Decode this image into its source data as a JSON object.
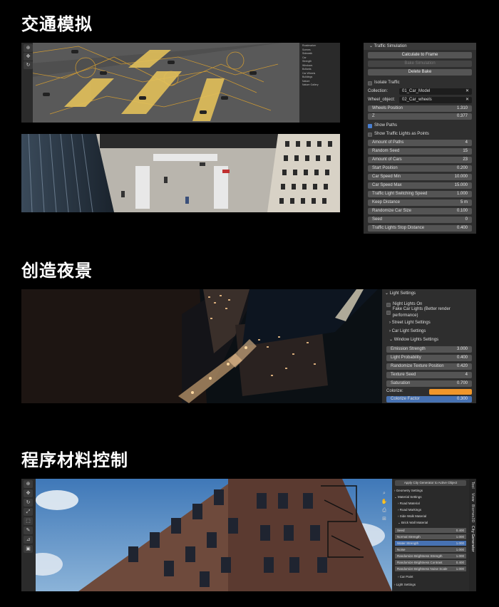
{
  "sections": {
    "traffic": {
      "title": "交通模拟"
    },
    "night": {
      "title": "创造夜景"
    },
    "materials": {
      "title": "程序材料控制"
    }
  },
  "traffic_panel": {
    "header": "Traffic Simulation",
    "buttons": [
      "Calculate to Frame",
      "Bake Simulation",
      "Delete Bake"
    ],
    "isolate_label": "Isolate Traffic",
    "collection_label": "Collection:",
    "collection_value": "01_Car_Model",
    "wheel_label": "Wheel_object:",
    "wheel_value": "02_Car_wheels",
    "wheels_position": {
      "label": "Wheels Position",
      "value": "1.310"
    },
    "z": {
      "label": "Z",
      "value": "0.377"
    },
    "show_paths": "Show Paths",
    "show_lights": "Show Traffic Lights as Points",
    "fields": [
      {
        "label": "Amount of Paths",
        "value": "4"
      },
      {
        "label": "Random Seed",
        "value": "15"
      },
      {
        "label": "Amount of Cars",
        "value": "23"
      },
      {
        "label": "Start Position",
        "value": "0.200"
      },
      {
        "label": "Car Speed Min",
        "value": "10.000"
      },
      {
        "label": "Car Speed Max",
        "value": "15.000"
      },
      {
        "label": "Traffic Light Switching Speed",
        "value": "1.000"
      },
      {
        "label": "Keep Distance",
        "value": "5 m"
      },
      {
        "label": "Randomize Car Size",
        "value": "0.100"
      },
      {
        "label": "Seed",
        "value": "0"
      },
      {
        "label": "Traffic Lights Stop Distance",
        "value": "0.400"
      }
    ],
    "close_glyph": "✕"
  },
  "light_panel": {
    "header": "Light Settings",
    "checks": [
      "Night Lights On",
      "Fake Car Lights (Better render performance)"
    ],
    "subs": [
      "Street Light Settings",
      "Car Light Settings",
      "Window Lights Settings"
    ],
    "fields": [
      {
        "label": "Emission Strength",
        "value": "3.000"
      },
      {
        "label": "Light Probability",
        "value": "0.400"
      },
      {
        "label": "Randomize Texture Position",
        "value": "0.420"
      },
      {
        "label": "Texture Seed",
        "value": "4"
      },
      {
        "label": "Saturation",
        "value": "0.700"
      }
    ],
    "colorize_label": "Colorize:",
    "colorize_color": "#f0962a",
    "factor": {
      "label": "Colorize Factor",
      "value": "0.300"
    }
  },
  "material_panel": {
    "apply_button": "Apply City Generator to Active Object",
    "items": [
      "Geometry Settings",
      "Material Settings",
      "Road Material",
      "Road Markings",
      "Side Walk Material",
      "Brick Wall Material"
    ],
    "fields": [
      {
        "label": "Seed",
        "value": "0.400"
      },
      {
        "label": "Normal Strength",
        "value": "1.000"
      },
      {
        "label": "Water Strength",
        "value": "1.000"
      },
      {
        "label": "Noise",
        "value": "1.000"
      },
      {
        "label": "Randomize Brightness Strength",
        "value": "1.000"
      },
      {
        "label": "Randomize Brightness Contrast",
        "value": "0.400"
      },
      {
        "label": "Randomize Brightness Noise Scale",
        "value": "1.000"
      }
    ],
    "car_paint": "Car Paint",
    "light_settings": "Light Settings",
    "tabs": [
      "Tool",
      "View",
      "Biomes3D",
      "City Generator"
    ]
  },
  "outliner": {
    "items": [
      "Roadmarker",
      "Scenes",
      "Sidewalk",
      "Car",
      "Strength",
      "Windows",
      "Bollards",
      "Car Wheels",
      "Buildings",
      "Nature",
      "Nature Gallery"
    ]
  }
}
